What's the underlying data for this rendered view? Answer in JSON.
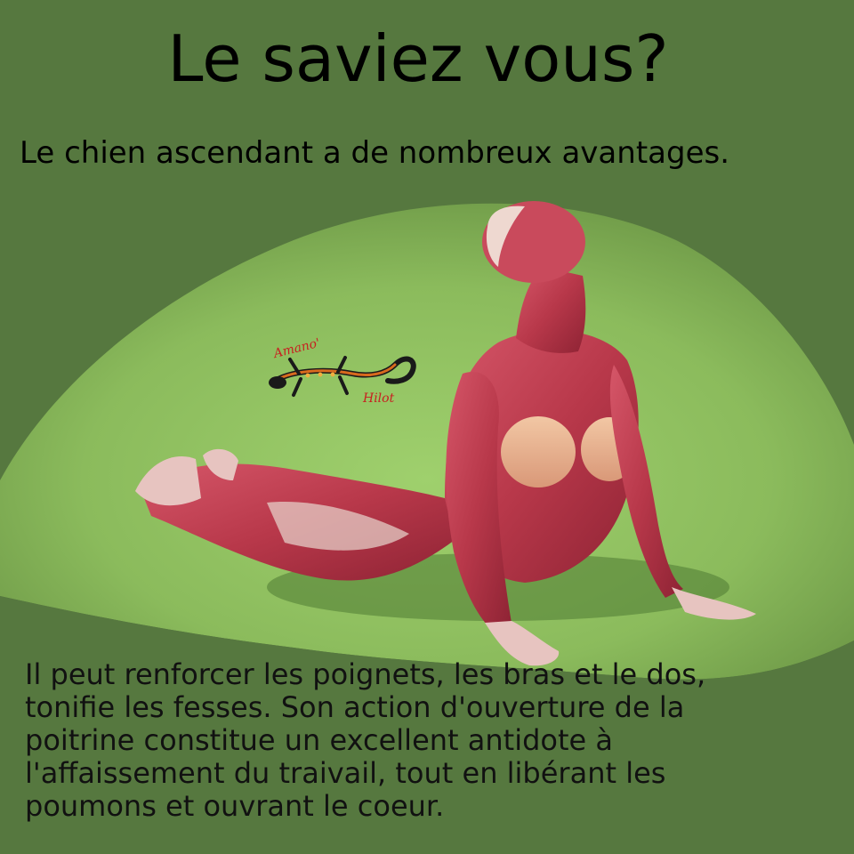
{
  "title": "Le saviez vous?",
  "subtitle": "Le chien ascendant a de nombreux avantages.",
  "logo": {
    "text_top": "Amano'",
    "text_bottom": "Hilot",
    "icon": "gecko-icon"
  },
  "image": {
    "subject": "anatomical-figure-upward-dog-pose"
  },
  "body_lines": [
    "Il peut renforcer les poignets, les bras et le dos,",
    "tonifie les fesses. Son action d'ouverture de la",
    "poitrine constitue un excellent antidote à",
    "l'affaissement du traivail, tout en libérant les",
    "poumons et ouvrant le coeur."
  ],
  "colors": {
    "background": "#56783f",
    "glow": "#8fbf5e",
    "muscle": "#b8384a",
    "text": "#000000"
  }
}
